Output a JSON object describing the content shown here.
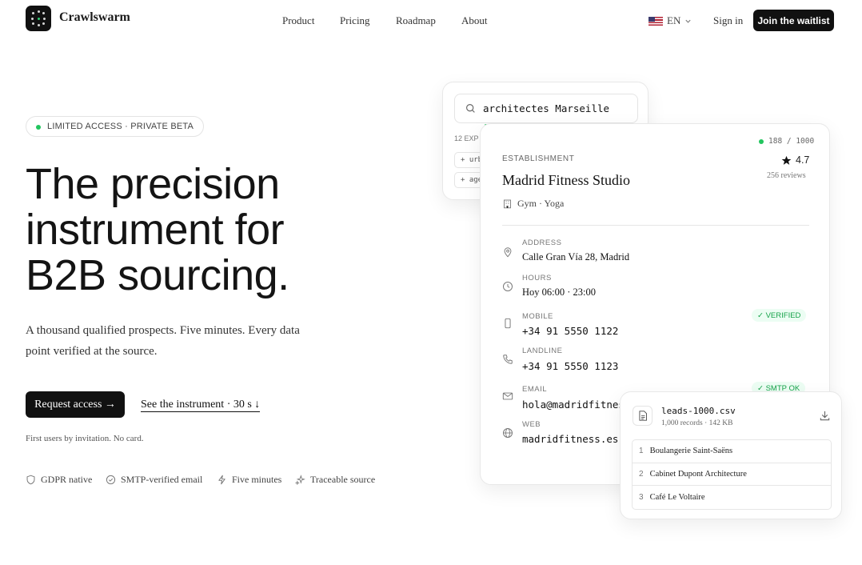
{
  "brand": {
    "name": "Crawlswarm"
  },
  "nav": {
    "items": [
      "Product",
      "Pricing",
      "Roadmap",
      "About"
    ]
  },
  "header": {
    "language": "EN",
    "sign_in": "Sign in",
    "cta": "Join the waitlist"
  },
  "hero": {
    "badge": "LIMITED ACCESS · PRIVATE BETA",
    "headline_lines": [
      "The precision",
      "instrument for",
      "B2B sourcing."
    ],
    "subheadline": "A thousand qualified prospects. Five minutes. Every data point verified at the source.",
    "primary_cta": "Request access →",
    "secondary_cta": "See the instrument · 30 s ↓",
    "note": "First users by invitation. No card.",
    "features": [
      "GDPR native",
      "SMTP-verified email",
      "Five minutes",
      "Traceable source"
    ]
  },
  "search_card": {
    "query": "architectes Marseille",
    "expansions_label": "12 EXP",
    "chips": [
      "+ urb",
      "+ age"
    ]
  },
  "establishment": {
    "eyebrow": "ESTABLISHMENT",
    "counter": "188 / 1000",
    "name": "Madrid Fitness Studio",
    "category": "Gym · Yoga",
    "rating": "4.7",
    "reviews": "256 reviews",
    "fields": {
      "address_label": "ADDRESS",
      "address": "Calle Gran Vía 28, Madrid",
      "hours_label": "HOURS",
      "hours": "Hoy 06:00 · 23:00",
      "mobile_label": "MOBILE",
      "mobile": "+34 91 5550 1122",
      "mobile_status": "✓ VERIFIED",
      "landline_label": "LANDLINE",
      "landline": "+34 91 5550 1123",
      "email_label": "EMAIL",
      "email": "hola@madridfitnes",
      "email_status": "✓ SMTP OK",
      "web_label": "WEB",
      "web": "madridfitness.es"
    }
  },
  "export": {
    "filename": "leads-1000.csv",
    "meta": "1,000 records · 142 KB",
    "rows": [
      {
        "n": "1",
        "name": "Boulangerie Saint-Saëns"
      },
      {
        "n": "2",
        "name": "Cabinet Dupont Architecture"
      },
      {
        "n": "3",
        "name": "Café Le Voltaire"
      }
    ]
  },
  "colors": {
    "accent_green": "#22c55e",
    "dark": "#111111"
  }
}
